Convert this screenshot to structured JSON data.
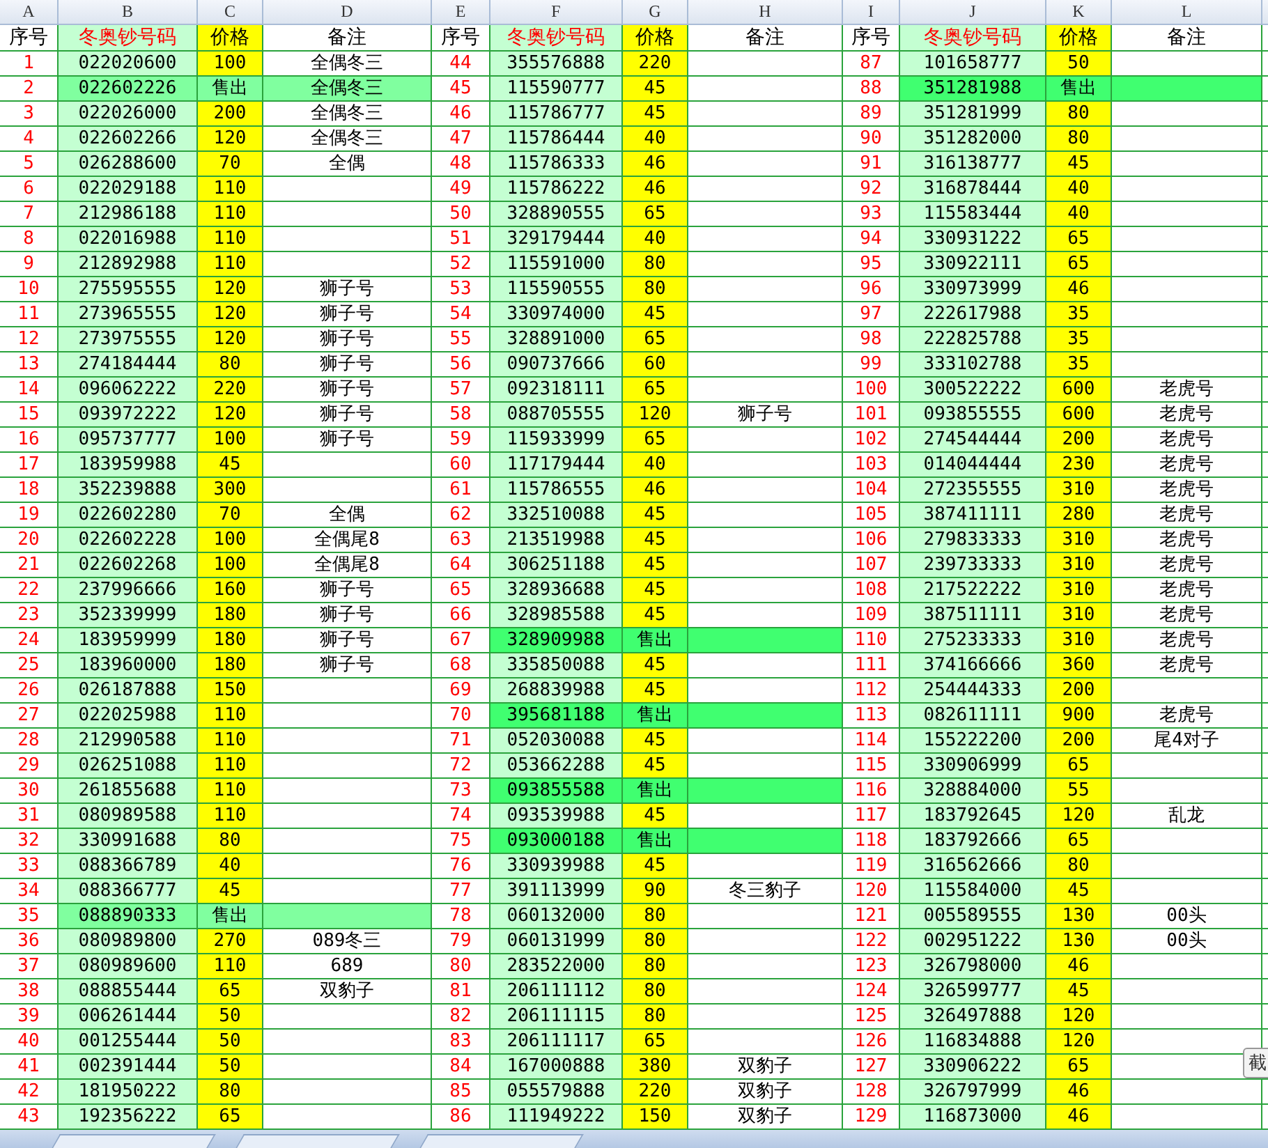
{
  "sections": [
    {
      "letters": [
        "A",
        "B",
        "C",
        "D"
      ],
      "headings": [
        "序号",
        "冬奥钞号码",
        "价格",
        "备注"
      ],
      "rows": [
        {
          "no": "1",
          "code": "022020600",
          "price": "100",
          "note": "全偶冬三",
          "sold": false
        },
        {
          "no": "2",
          "code": "022602226",
          "price": "售出",
          "note": "全偶冬三",
          "sold": true,
          "color": "#80ff9f"
        },
        {
          "no": "3",
          "code": "022026000",
          "price": "200",
          "note": "全偶冬三",
          "sold": false
        },
        {
          "no": "4",
          "code": "022602266",
          "price": "120",
          "note": "全偶冬三",
          "sold": false
        },
        {
          "no": "5",
          "code": "026288600",
          "price": "70",
          "note": "全偶",
          "sold": false
        },
        {
          "no": "6",
          "code": "022029188",
          "price": "110",
          "sold": false
        },
        {
          "no": "7",
          "code": "212986188",
          "price": "110",
          "sold": false
        },
        {
          "no": "8",
          "code": "022016988",
          "price": "110",
          "sold": false
        },
        {
          "no": "9",
          "code": "212892988",
          "price": "110",
          "sold": false
        },
        {
          "no": "10",
          "code": "275595555",
          "price": "120",
          "note": "狮子号",
          "sold": false
        },
        {
          "no": "11",
          "code": "273965555",
          "price": "120",
          "note": "狮子号",
          "sold": false
        },
        {
          "no": "12",
          "code": "273975555",
          "price": "120",
          "note": "狮子号",
          "sold": false
        },
        {
          "no": "13",
          "code": "274184444",
          "price": "80",
          "note": "狮子号",
          "sold": false
        },
        {
          "no": "14",
          "code": "096062222",
          "price": "220",
          "note": "狮子号",
          "sold": false
        },
        {
          "no": "15",
          "code": "093972222",
          "price": "120",
          "note": "狮子号",
          "sold": false
        },
        {
          "no": "16",
          "code": "095737777",
          "price": "100",
          "note": "狮子号",
          "sold": false
        },
        {
          "no": "17",
          "code": "183959988",
          "price": "45",
          "sold": false
        },
        {
          "no": "18",
          "code": "352239888",
          "price": "300",
          "sold": false
        },
        {
          "no": "19",
          "code": "022602280",
          "price": "70",
          "note": "全偶",
          "sold": false
        },
        {
          "no": "20",
          "code": "022602228",
          "price": "100",
          "note": "全偶尾8",
          "sold": false
        },
        {
          "no": "21",
          "code": "022602268",
          "price": "100",
          "note": "全偶尾8",
          "sold": false
        },
        {
          "no": "22",
          "code": "237996666",
          "price": "160",
          "note": "狮子号",
          "sold": false
        },
        {
          "no": "23",
          "code": "352339999",
          "price": "180",
          "note": "狮子号",
          "sold": false
        },
        {
          "no": "24",
          "code": "183959999",
          "price": "180",
          "note": "狮子号",
          "sold": false
        },
        {
          "no": "25",
          "code": "183960000",
          "price": "180",
          "note": "狮子号",
          "sold": false
        },
        {
          "no": "26",
          "code": "026187888",
          "price": "150",
          "sold": false
        },
        {
          "no": "27",
          "code": "022025988",
          "price": "110",
          "sold": false
        },
        {
          "no": "28",
          "code": "212990588",
          "price": "110",
          "sold": false
        },
        {
          "no": "29",
          "code": "026251088",
          "price": "110",
          "sold": false
        },
        {
          "no": "30",
          "code": "261855688",
          "price": "110",
          "sold": false
        },
        {
          "no": "31",
          "code": "080989588",
          "price": "110",
          "sold": false
        },
        {
          "no": "32",
          "code": "330991688",
          "price": "80",
          "sold": false
        },
        {
          "no": "33",
          "code": "088366789",
          "price": "40",
          "sold": false
        },
        {
          "no": "34",
          "code": "088366777",
          "price": "45",
          "sold": false
        },
        {
          "no": "35",
          "code": "088890333",
          "price": "售出",
          "sold": true,
          "color": "#80ff9f"
        },
        {
          "no": "36",
          "code": "080989800",
          "price": "270",
          "note": "089冬三",
          "sold": false
        },
        {
          "no": "37",
          "code": "080989600",
          "price": "110",
          "note": "689",
          "sold": false
        },
        {
          "no": "38",
          "code": "088855444",
          "price": "65",
          "note": "双豹子",
          "sold": false
        },
        {
          "no": "39",
          "code": "006261444",
          "price": "50",
          "sold": false
        },
        {
          "no": "40",
          "code": "001255444",
          "price": "50",
          "sold": false
        },
        {
          "no": "41",
          "code": "002391444",
          "price": "50",
          "sold": false
        },
        {
          "no": "42",
          "code": "181950222",
          "price": "80",
          "sold": false
        },
        {
          "no": "43",
          "code": "192356222",
          "price": "65",
          "sold": false
        }
      ]
    },
    {
      "letters": [
        "E",
        "F",
        "G",
        "H"
      ],
      "headings": [
        "序号",
        "冬奥钞号码",
        "价格",
        "备注"
      ],
      "rows": [
        {
          "no": "44",
          "code": "355576888",
          "price": "220",
          "sold": false
        },
        {
          "no": "45",
          "code": "115590777",
          "price": "45",
          "sold": false
        },
        {
          "no": "46",
          "code": "115786777",
          "price": "45",
          "sold": false
        },
        {
          "no": "47",
          "code": "115786444",
          "price": "40",
          "sold": false
        },
        {
          "no": "48",
          "code": "115786333",
          "price": "46",
          "sold": false
        },
        {
          "no": "49",
          "code": "115786222",
          "price": "46",
          "sold": false
        },
        {
          "no": "50",
          "code": "328890555",
          "price": "65",
          "sold": false
        },
        {
          "no": "51",
          "code": "329179444",
          "price": "40",
          "sold": false
        },
        {
          "no": "52",
          "code": "115591000",
          "price": "80",
          "sold": false
        },
        {
          "no": "53",
          "code": "115590555",
          "price": "80",
          "sold": false
        },
        {
          "no": "54",
          "code": "330974000",
          "price": "45",
          "sold": false
        },
        {
          "no": "55",
          "code": "328891000",
          "price": "65",
          "sold": false
        },
        {
          "no": "56",
          "code": "090737666",
          "price": "60",
          "sold": false
        },
        {
          "no": "57",
          "code": "092318111",
          "price": "65",
          "sold": false
        },
        {
          "no": "58",
          "code": "088705555",
          "price": "120",
          "note": "狮子号",
          "sold": false
        },
        {
          "no": "59",
          "code": "115933999",
          "price": "65",
          "sold": false
        },
        {
          "no": "60",
          "code": "117179444",
          "price": "40",
          "sold": false
        },
        {
          "no": "61",
          "code": "115786555",
          "price": "46",
          "sold": false
        },
        {
          "no": "62",
          "code": "332510088",
          "price": "45",
          "sold": false
        },
        {
          "no": "63",
          "code": "213519988",
          "price": "45",
          "sold": false
        },
        {
          "no": "64",
          "code": "306251188",
          "price": "45",
          "sold": false
        },
        {
          "no": "65",
          "code": "328936688",
          "price": "45",
          "sold": false
        },
        {
          "no": "66",
          "code": "328985588",
          "price": "45",
          "sold": false
        },
        {
          "no": "67",
          "code": "328909988",
          "price": "售出",
          "sold": true,
          "color": "#40ff70"
        },
        {
          "no": "68",
          "code": "335850088",
          "price": "45",
          "sold": false
        },
        {
          "no": "69",
          "code": "268839988",
          "price": "45",
          "sold": false
        },
        {
          "no": "70",
          "code": "395681188",
          "price": "售出",
          "sold": true,
          "color": "#40ff70"
        },
        {
          "no": "71",
          "code": "052030088",
          "price": "45",
          "sold": false
        },
        {
          "no": "72",
          "code": "053662288",
          "price": "45",
          "sold": false
        },
        {
          "no": "73",
          "code": "093855588",
          "price": "售出",
          "sold": true,
          "color": "#40ff70"
        },
        {
          "no": "74",
          "code": "093539988",
          "price": "45",
          "sold": false
        },
        {
          "no": "75",
          "code": "093000188",
          "price": "售出",
          "sold": true,
          "color": "#40ff70"
        },
        {
          "no": "76",
          "code": "330939988",
          "price": "45",
          "sold": false
        },
        {
          "no": "77",
          "code": "391113999",
          "price": "90",
          "note": "冬三豹子",
          "sold": false
        },
        {
          "no": "78",
          "code": "060132000",
          "price": "80",
          "sold": false
        },
        {
          "no": "79",
          "code": "060131999",
          "price": "80",
          "sold": false
        },
        {
          "no": "80",
          "code": "283522000",
          "price": "80",
          "sold": false
        },
        {
          "no": "81",
          "code": "206111112",
          "price": "80",
          "sold": false
        },
        {
          "no": "82",
          "code": "206111115",
          "price": "80",
          "sold": false
        },
        {
          "no": "83",
          "code": "206111117",
          "price": "65",
          "sold": false
        },
        {
          "no": "84",
          "code": "167000888",
          "price": "380",
          "note": "双豹子",
          "sold": false
        },
        {
          "no": "85",
          "code": "055579888",
          "price": "220",
          "note": "双豹子",
          "sold": false
        },
        {
          "no": "86",
          "code": "111949222",
          "price": "150",
          "note": "双豹子",
          "sold": false
        }
      ]
    },
    {
      "letters": [
        "I",
        "J",
        "K",
        "L"
      ],
      "headings": [
        "序号",
        "冬奥钞号码",
        "价格",
        "备注"
      ],
      "rows": [
        {
          "no": "87",
          "code": "101658777",
          "price": "50",
          "sold": false
        },
        {
          "no": "88",
          "code": "351281988",
          "price": "售出",
          "sold": true,
          "color": "#40ff70"
        },
        {
          "no": "89",
          "code": "351281999",
          "price": "80",
          "sold": false
        },
        {
          "no": "90",
          "code": "351282000",
          "price": "80",
          "sold": false
        },
        {
          "no": "91",
          "code": "316138777",
          "price": "45",
          "sold": false
        },
        {
          "no": "92",
          "code": "316878444",
          "price": "40",
          "sold": false
        },
        {
          "no": "93",
          "code": "115583444",
          "price": "40",
          "sold": false
        },
        {
          "no": "94",
          "code": "330931222",
          "price": "65",
          "sold": false
        },
        {
          "no": "95",
          "code": "330922111",
          "price": "65",
          "sold": false
        },
        {
          "no": "96",
          "code": "330973999",
          "price": "46",
          "sold": false
        },
        {
          "no": "97",
          "code": "222617988",
          "price": "35",
          "sold": false
        },
        {
          "no": "98",
          "code": "222825788",
          "price": "35",
          "sold": false
        },
        {
          "no": "99",
          "code": "333102788",
          "price": "35",
          "sold": false
        },
        {
          "no": "100",
          "code": "300522222",
          "price": "600",
          "note": "老虎号",
          "sold": false
        },
        {
          "no": "101",
          "code": "093855555",
          "price": "600",
          "note": "老虎号",
          "sold": false
        },
        {
          "no": "102",
          "code": "274544444",
          "price": "200",
          "note": "老虎号",
          "sold": false
        },
        {
          "no": "103",
          "code": "014044444",
          "price": "230",
          "note": "老虎号",
          "sold": false
        },
        {
          "no": "104",
          "code": "272355555",
          "price": "310",
          "note": "老虎号",
          "sold": false
        },
        {
          "no": "105",
          "code": "387411111",
          "price": "280",
          "note": "老虎号",
          "sold": false
        },
        {
          "no": "106",
          "code": "279833333",
          "price": "310",
          "note": "老虎号",
          "sold": false
        },
        {
          "no": "107",
          "code": "239733333",
          "price": "310",
          "note": "老虎号",
          "sold": false
        },
        {
          "no": "108",
          "code": "217522222",
          "price": "310",
          "note": "老虎号",
          "sold": false
        },
        {
          "no": "109",
          "code": "387511111",
          "price": "310",
          "note": "老虎号",
          "sold": false
        },
        {
          "no": "110",
          "code": "275233333",
          "price": "310",
          "note": "老虎号",
          "sold": false
        },
        {
          "no": "111",
          "code": "374166666",
          "price": "360",
          "note": "老虎号",
          "sold": false
        },
        {
          "no": "112",
          "code": "254444333",
          "price": "200",
          "sold": false
        },
        {
          "no": "113",
          "code": "082611111",
          "price": "900",
          "note": "老虎号",
          "sold": false
        },
        {
          "no": "114",
          "code": "155222200",
          "price": "200",
          "note": "尾4对子",
          "sold": false
        },
        {
          "no": "115",
          "code": "330906999",
          "price": "65",
          "sold": false
        },
        {
          "no": "116",
          "code": "328884000",
          "price": "55",
          "sold": false
        },
        {
          "no": "117",
          "code": "183792645",
          "price": "120",
          "note": "乱龙",
          "sold": false
        },
        {
          "no": "118",
          "code": "183792666",
          "price": "65",
          "sold": false
        },
        {
          "no": "119",
          "code": "316562666",
          "price": "80",
          "sold": false
        },
        {
          "no": "120",
          "code": "115584000",
          "price": "45",
          "sold": false
        },
        {
          "no": "121",
          "code": "005589555",
          "price": "130",
          "note": "00头",
          "sold": false
        },
        {
          "no": "122",
          "code": "002951222",
          "price": "130",
          "note": "00头",
          "sold": false
        },
        {
          "no": "123",
          "code": "326798000",
          "price": "46",
          "sold": false
        },
        {
          "no": "124",
          "code": "326599777",
          "price": "45",
          "sold": false
        },
        {
          "no": "125",
          "code": "326497888",
          "price": "120",
          "sold": false
        },
        {
          "no": "126",
          "code": "116834888",
          "price": "120",
          "sold": false
        },
        {
          "no": "127",
          "code": "330906222",
          "price": "65",
          "sold": false
        },
        {
          "no": "128",
          "code": "326797999",
          "price": "46",
          "sold": false
        },
        {
          "no": "129",
          "code": "116873000",
          "price": "46",
          "sold": false
        }
      ]
    }
  ],
  "overlay_button": {
    "label": "截"
  }
}
